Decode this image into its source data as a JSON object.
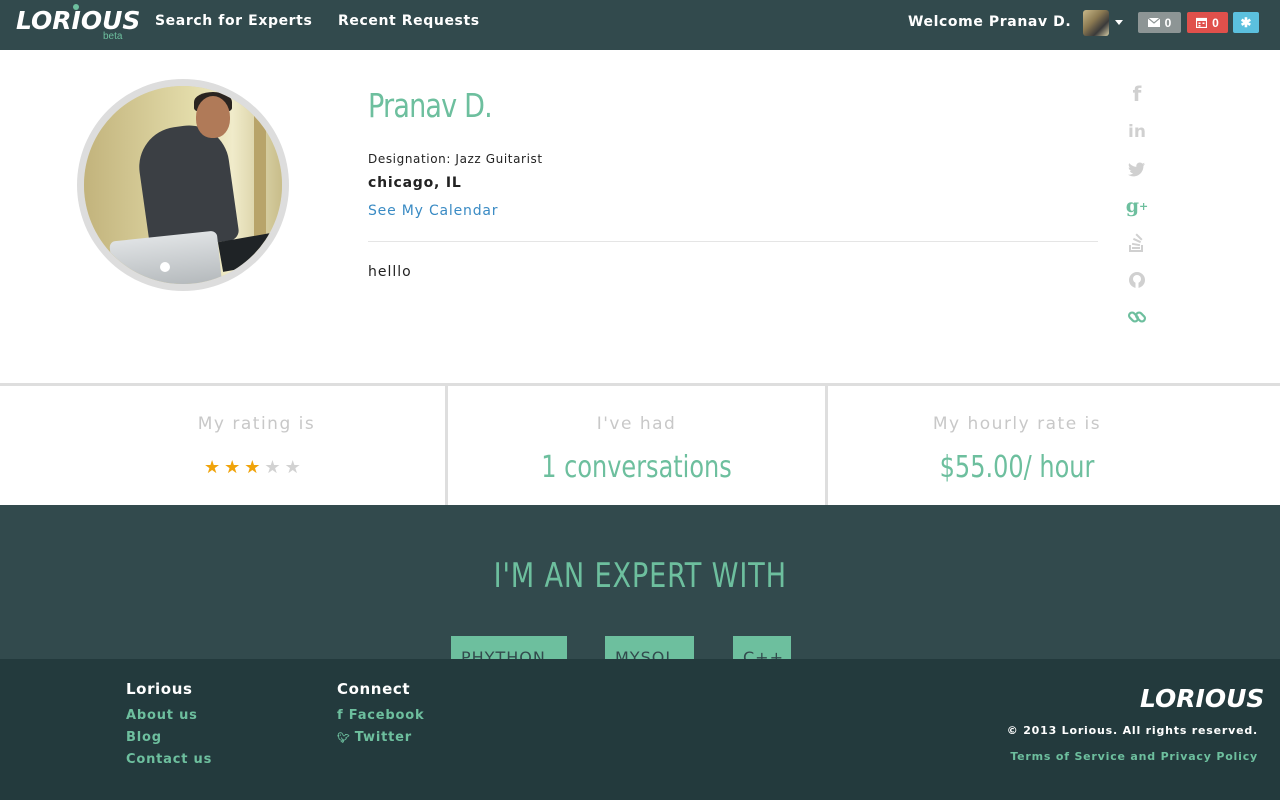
{
  "header": {
    "logo": "LORIOUS",
    "beta": "beta",
    "nav": [
      "Search for Experts",
      "Recent Requests"
    ],
    "welcome": "Welcome Pranav D.",
    "mail_count": "0",
    "calendar_count": "0"
  },
  "profile": {
    "name": "Pranav D.",
    "designation": "Designation: Jazz Guitarist",
    "location": "chicago, IL",
    "calendar_link": "See My Calendar",
    "bio": "helllo",
    "social_icons": [
      "facebook-icon",
      "linkedin-icon",
      "twitter-icon",
      "google-plus-icon",
      "stackoverflow-icon",
      "github-icon",
      "link-icon"
    ],
    "social_active_color": "#6dbf9e",
    "social_inactive_color": "#d0d0d0"
  },
  "stats": {
    "rating_label": "My rating is",
    "rating": 3,
    "rating_max": 5,
    "conversations_label": "I've had",
    "conversations_value": "1 conversations",
    "rate_label": "My hourly rate is",
    "rate_value": "$55.00/ hour"
  },
  "expertise": {
    "title": "I'M AN EXPERT WITH",
    "skills": [
      "PHYTHON",
      "MYSQL",
      "C++"
    ]
  },
  "footer": {
    "col1_title": "Lorious",
    "col1_links": [
      "About us",
      "Blog",
      "Contact us"
    ],
    "col2_title": "Connect",
    "col2_links": [
      "Facebook",
      "Twitter"
    ],
    "logo": "LORIOUS",
    "copyright": "© 2013 Lorious. All rights reserved.",
    "terms": "Terms of Service and Privacy Policy"
  },
  "colors": {
    "header_bg": "#324a4d",
    "accent": "#6dbf9e",
    "footer_bg": "#233a3d",
    "link": "#3a8bc4"
  }
}
